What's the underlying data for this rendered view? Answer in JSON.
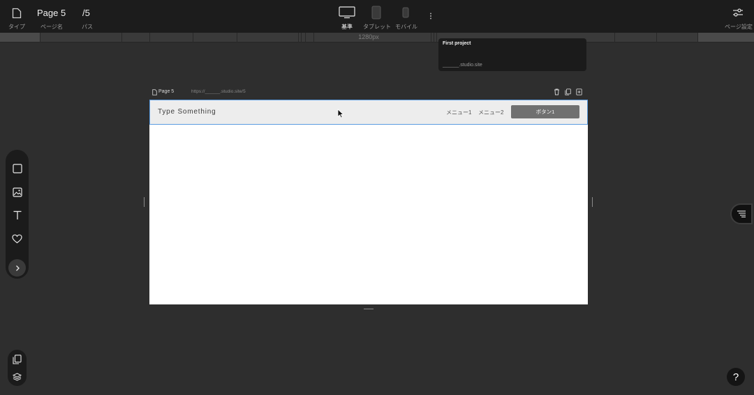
{
  "topbar": {
    "type_label": "タイプ",
    "page_name_value": "Page 5",
    "page_name_label": "ページ名",
    "path_value": "/5",
    "path_label": "パス",
    "devices": [
      {
        "label": "基準",
        "active": true
      },
      {
        "label": "タブレット",
        "active": false
      },
      {
        "label": "モバイル",
        "active": false
      }
    ],
    "page_settings_label": "ページ設定"
  },
  "ruler": {
    "width_label": "1280px"
  },
  "project_popup": {
    "title": "First project",
    "domain": "______.studio.site"
  },
  "frame": {
    "page_name": "Page 5",
    "url": "https://______.studio.site/5"
  },
  "site_header": {
    "logo_text": "Type Something",
    "menu": [
      "メニュー1",
      "メニュー2"
    ],
    "button_label": "ボタン1",
    "border_color": "#5a9be0"
  },
  "left_toolbar": {
    "icons": [
      "box-icon",
      "image-icon",
      "text-icon",
      "heart-icon",
      "chevron-right-icon"
    ]
  },
  "bottom_toolbar": {
    "icons": [
      "pages-icon",
      "layers-icon"
    ]
  },
  "help": {
    "label": "?"
  },
  "colors": {
    "app_bg": "#2e2e2e",
    "topbar_bg": "#1c1c1c",
    "accent_selection": "#5a9be0",
    "site_button_bg": "#707070"
  }
}
